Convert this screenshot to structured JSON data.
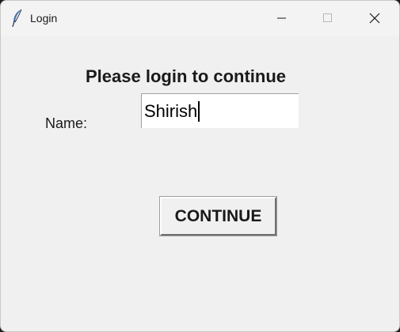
{
  "window": {
    "title": "Login",
    "icon": "feather-icon"
  },
  "form": {
    "heading": "Please login to continue",
    "name_label": "Name:",
    "name_value": "Shirish",
    "continue_label": "CONTINUE"
  },
  "colors": {
    "window_bg": "#f0f0f0",
    "titlebar_bg": "#f3f3f3",
    "text": "#1a1a1a"
  }
}
